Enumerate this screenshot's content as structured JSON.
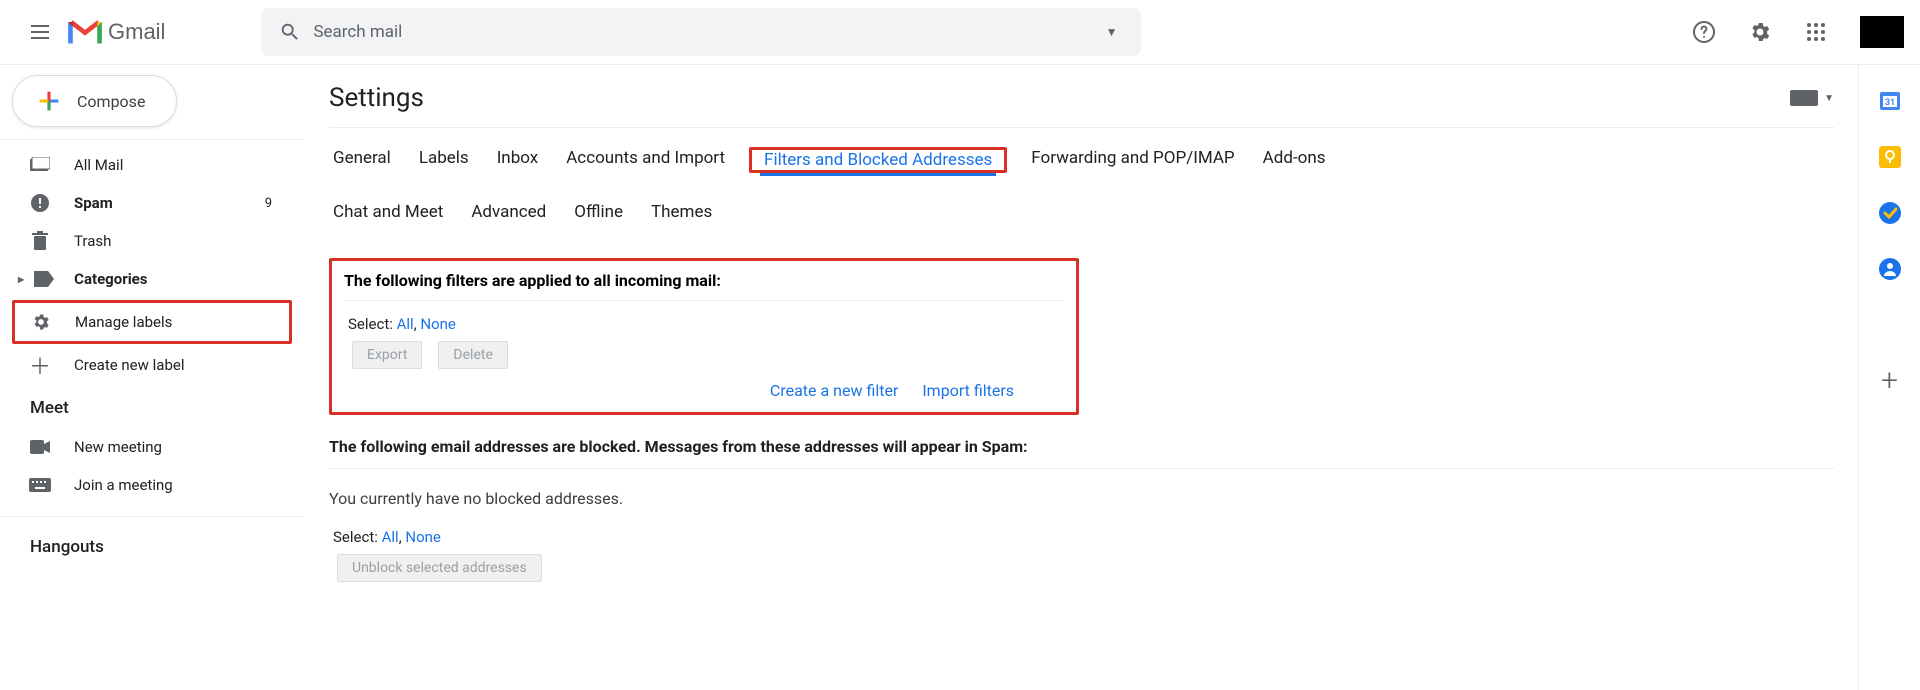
{
  "header": {
    "logo_text": "Gmail",
    "search_placeholder": "Search mail"
  },
  "compose_label": "Compose",
  "sidebar": {
    "allmail": "All Mail",
    "spam": "Spam",
    "spam_count": "9",
    "trash": "Trash",
    "categories": "Categories",
    "manage_labels": "Manage labels",
    "create_label": "Create new label"
  },
  "meet": {
    "title": "Meet",
    "new_meeting": "New meeting",
    "join_meeting": "Join a meeting"
  },
  "hangouts_title": "Hangouts",
  "page_title": "Settings",
  "tabs": {
    "general": "General",
    "labels": "Labels",
    "inbox": "Inbox",
    "accounts": "Accounts and Import",
    "filters": "Filters and Blocked Addresses",
    "forwarding": "Forwarding and POP/IMAP",
    "addons": "Add-ons",
    "chat": "Chat and Meet",
    "advanced": "Advanced",
    "offline": "Offline",
    "themes": "Themes"
  },
  "filters": {
    "heading": "The following filters are applied to all incoming mail:",
    "select_label": "Select:",
    "all": "All",
    "none": "None",
    "export": "Export",
    "delete": "Delete",
    "create": "Create a new filter",
    "import": "Import filters"
  },
  "blocked": {
    "heading": "The following email addresses are blocked. Messages from these addresses will appear in Spam:",
    "empty": "You currently have no blocked addresses.",
    "select_label": "Select:",
    "all": "All",
    "none": "None",
    "unblock": "Unblock selected addresses"
  }
}
